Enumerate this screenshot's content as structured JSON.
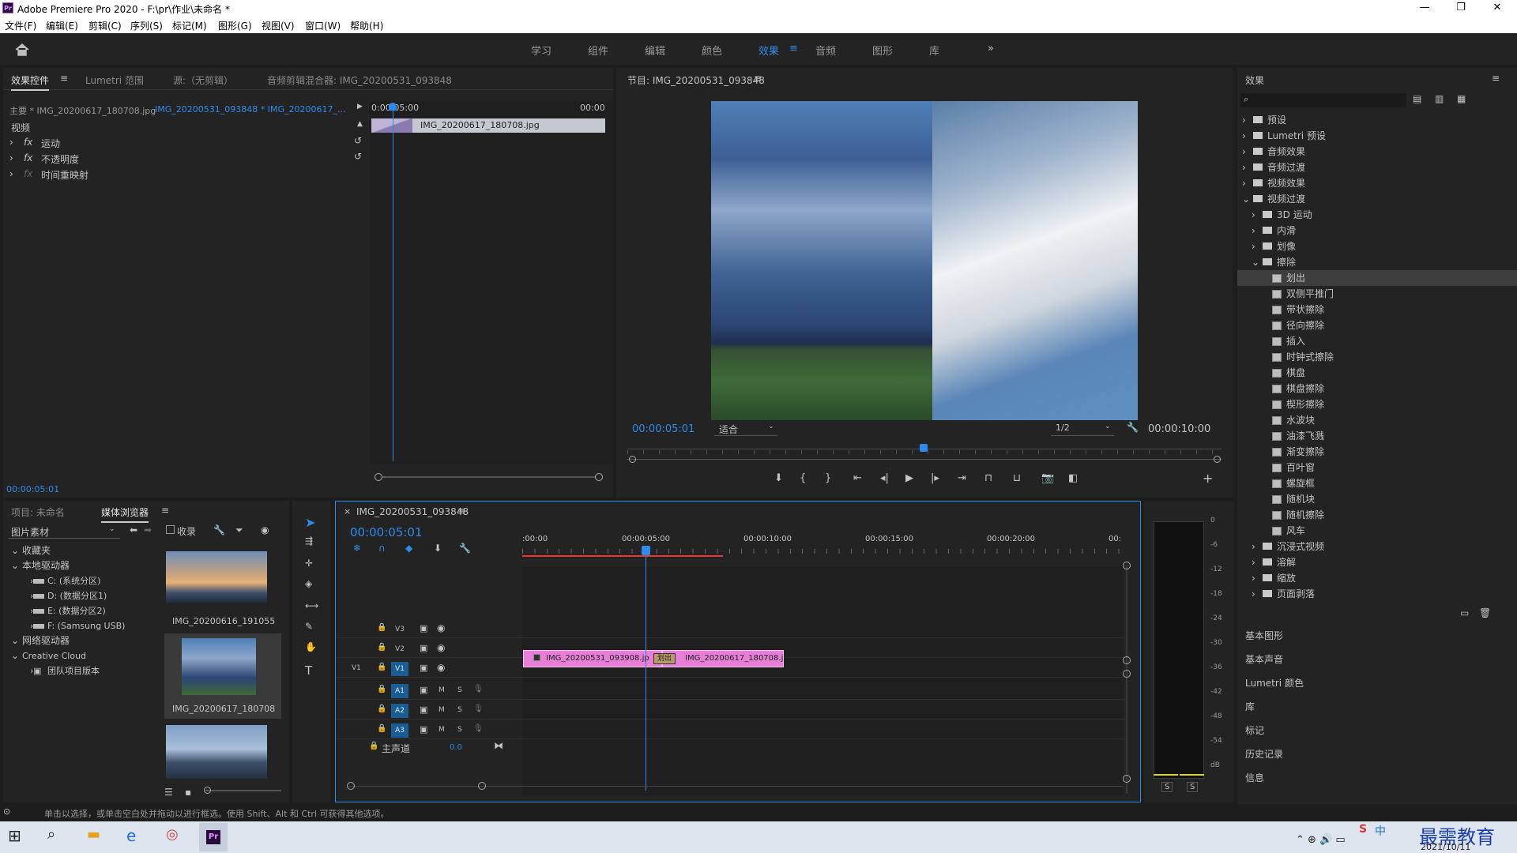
{
  "app": {
    "title": "Adobe Premiere Pro 2020 - F:\\pr\\作业\\未命名 *",
    "logo": "Pr"
  },
  "menu": [
    "文件(F)",
    "编辑(E)",
    "剪辑(C)",
    "序列(S)",
    "标记(M)",
    "图形(G)",
    "视图(V)",
    "窗口(W)",
    "帮助(H)"
  ],
  "workspaces": {
    "tabs": [
      "学习",
      "组件",
      "编辑",
      "颜色",
      "效果",
      "音频",
      "图形",
      "库"
    ],
    "active": "效果",
    "more": "»"
  },
  "effect_controls": {
    "tabs": [
      "效果控件",
      "Lumetri 范围",
      "源:（无剪辑）",
      "音频剪辑混合器: IMG_20200531_093848"
    ],
    "master": "主要 * IMG_20200617_180708.jpg",
    "sequence": "IMG_20200531_093848 * IMG_20200617_...",
    "time_start": "0:00:05:00",
    "time_end": "00:00",
    "section": "视频",
    "clip_label": "IMG_20200617_180708.jpg",
    "rows": [
      "运动",
      "不透明度",
      "时间重映射"
    ],
    "fx": "fx",
    "timecode": "00:00:05:01"
  },
  "program": {
    "title": "节目: IMG_20200531_093848",
    "timecode": "00:00:05:01",
    "fit": "适合",
    "quality": "1/2",
    "duration": "00:00:10:00"
  },
  "effects": {
    "title": "效果",
    "folders_top": [
      "预设",
      "Lumetri 预设",
      "音频效果",
      "音频过渡",
      "视频效果",
      "视频过渡"
    ],
    "sub_folders": [
      "3D 运动",
      "内滑",
      "划像",
      "擦除"
    ],
    "wipe_items": [
      "划出",
      "双侧平推门",
      "带状擦除",
      "径向擦除",
      "插入",
      "时钟式擦除",
      "棋盘",
      "棋盘擦除",
      "楔形擦除",
      "水波块",
      "油漆飞溅",
      "渐变擦除",
      "百叶窗",
      "螺旋框",
      "随机块",
      "随机擦除",
      "风车"
    ],
    "more_folders": [
      "沉浸式视频",
      "溶解",
      "缩放",
      "页面剥落"
    ],
    "bottom_panels": [
      "基本图形",
      "基本声音",
      "Lumetri 颜色",
      "库",
      "标记",
      "历史记录",
      "信息"
    ]
  },
  "media": {
    "tabs": [
      "项目: 未命名",
      "媒体浏览器"
    ],
    "filter": "图片素材",
    "ingest": "收录",
    "tree": [
      "收藏夹",
      "本地驱动器",
      "C: (系统分区)",
      "D: (数据分区1)",
      "E: (数据分区2)",
      "F: (Samsung USB)",
      "网络驱动器",
      "Creative Cloud",
      "团队项目版本"
    ],
    "thumbs": [
      "IMG_20200616_191055",
      "IMG_20200617_180708"
    ]
  },
  "timeline": {
    "tab": "IMG_20200531_093848",
    "timecode": "00:00:05:01",
    "ruler": [
      ":00:00",
      "00:00:05:00",
      "00:00:10:00",
      "00:00:15:00",
      "00:00:20:00",
      "00:"
    ],
    "tracks_video": [
      "V3",
      "V2",
      "V1"
    ],
    "tracks_audio": [
      "A1",
      "A2",
      "A3"
    ],
    "master": "主声道",
    "master_val": "0.0",
    "source_v1": "V1",
    "clip1": "IMG_20200531_093908.jp",
    "clip2": "IMG_20200617_180708.j",
    "transition": "划出",
    "m": "M",
    "s": "S"
  },
  "meter": {
    "scale": [
      "0",
      "-6",
      "-12",
      "-18",
      "-24",
      "-30",
      "-36",
      "-42",
      "-48",
      "-54",
      "dB"
    ],
    "solo": "S"
  },
  "status": "单击以选择，或单击空白处并拖动以进行框选。使用 Shift、Alt 和 Ctrl 可获得其他选项。",
  "taskbar": {
    "date": "2021/10/11",
    "watermark": "最需教育",
    "ime": "中"
  }
}
